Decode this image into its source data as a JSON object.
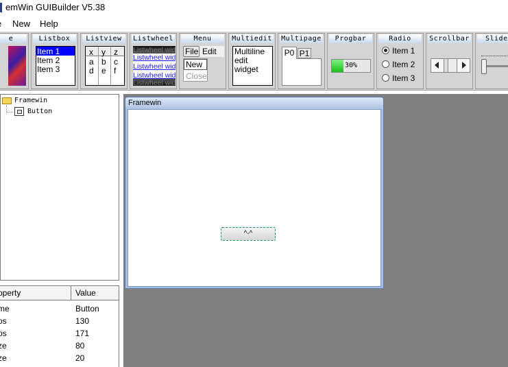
{
  "window": {
    "title": "emWin GUIBuilder V5.38"
  },
  "menubar": {
    "items": [
      "e",
      "New",
      "Help"
    ]
  },
  "palette": {
    "image_caption": "e",
    "listbox": {
      "caption": "Listbox",
      "items": [
        "Item 1",
        "Item 2",
        "Item 3"
      ]
    },
    "listview": {
      "caption": "Listview",
      "header": [
        "x",
        "y",
        "z"
      ],
      "rows": [
        [
          "a",
          "b",
          "c"
        ],
        [
          "d",
          "e",
          "f"
        ]
      ]
    },
    "listwheel": {
      "caption": "Listwheel",
      "items": [
        "Listwheel wid",
        "Listwheel wid",
        "Listwheel wid",
        "Listwheel wid",
        "Listwheel wid"
      ]
    },
    "menu": {
      "caption": "Menu",
      "bar": [
        "File",
        "Edit"
      ],
      "popup": [
        "New",
        "Close"
      ]
    },
    "multiedit": {
      "caption": "Multiedit",
      "lines": [
        "Multiline",
        "edit",
        "widget"
      ]
    },
    "multipage": {
      "caption": "Multipage",
      "tabs": [
        "P0",
        "P1"
      ]
    },
    "progbar": {
      "caption": "Progbar",
      "label": "30%",
      "value": 0.3
    },
    "radio": {
      "caption": "Radio",
      "items": [
        "Item 1",
        "Item 2",
        "Item 3"
      ],
      "selected": 0
    },
    "scrollbar": {
      "caption": "Scrollbar"
    },
    "slider": {
      "caption": "Slider"
    }
  },
  "tree": {
    "items": [
      "Framewin",
      "Button"
    ]
  },
  "properties": {
    "headers": [
      "operty",
      "Value"
    ],
    "rows": [
      {
        "name": "me",
        "value": "Button"
      },
      {
        "name": "os",
        "value": "130"
      },
      {
        "name": "os",
        "value": "171"
      },
      {
        "name": "ze",
        "value": "80"
      },
      {
        "name": "ze",
        "value": "20"
      }
    ]
  },
  "editor": {
    "framewin_title": "Framewin",
    "button_label": "^-^"
  },
  "colors": {
    "selection": "#0000ff",
    "workspace": "#808080",
    "progress": "#2ecc40",
    "caption_bg": "#c8d8ee"
  }
}
